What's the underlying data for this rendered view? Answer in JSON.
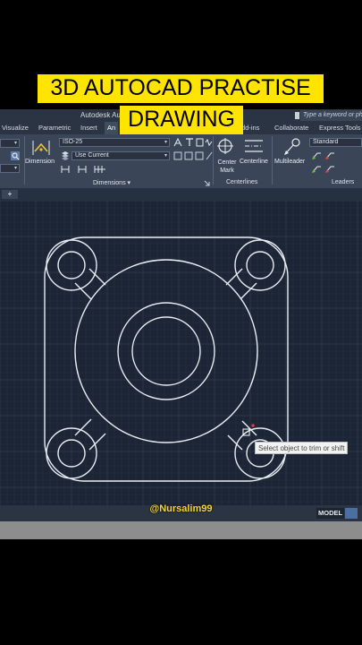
{
  "overlay": {
    "line1": "3D AUTOCAD PRACTISE",
    "line2": "DRAWING",
    "watermark": "@Nursalim99"
  },
  "app": {
    "title": "Autodesk Au",
    "search_placeholder": "Type a keyword or phr"
  },
  "tabs": [
    "Visualize",
    "Parametric",
    "Insert",
    "An",
    "dd-ins",
    "Collaborate",
    "Express Tools"
  ],
  "ribbon": {
    "dim_style": "ISO-25",
    "layer": "Use Current",
    "dimension_label": "Dimension",
    "dimensions_panel": "Dimensions ▾",
    "center_mark": "Center Mark",
    "centerline": "Centerline",
    "centerlines_panel": "Centerlines",
    "multileader": "Multileader",
    "leader_style": "Standard",
    "leaders_panel": "Leaders"
  },
  "prompt": "Select object to trim or shift",
  "status": {
    "model": "MODEL"
  },
  "colors": {
    "ribbon": "#3a4658",
    "canvas": "#1c2535",
    "highlight": "#ffe400",
    "watermark": "#f5d43a"
  }
}
